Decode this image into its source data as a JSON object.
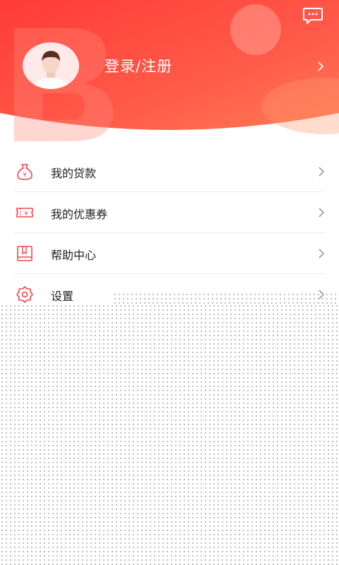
{
  "header": {
    "login_label": "登录/注册",
    "gradient_start": "#ff3c3c",
    "gradient_end": "#ff6a45"
  },
  "menu": {
    "items": [
      {
        "label": "我的贷款",
        "icon": "money-bag-icon"
      },
      {
        "label": "我的优惠券",
        "icon": "coupon-icon"
      },
      {
        "label": "帮助中心",
        "icon": "book-icon"
      },
      {
        "label": "设置",
        "icon": "gear-icon"
      }
    ]
  },
  "colors": {
    "accent": "#ff4b4b",
    "icon_red": "#f2454a",
    "text": "#222222"
  }
}
